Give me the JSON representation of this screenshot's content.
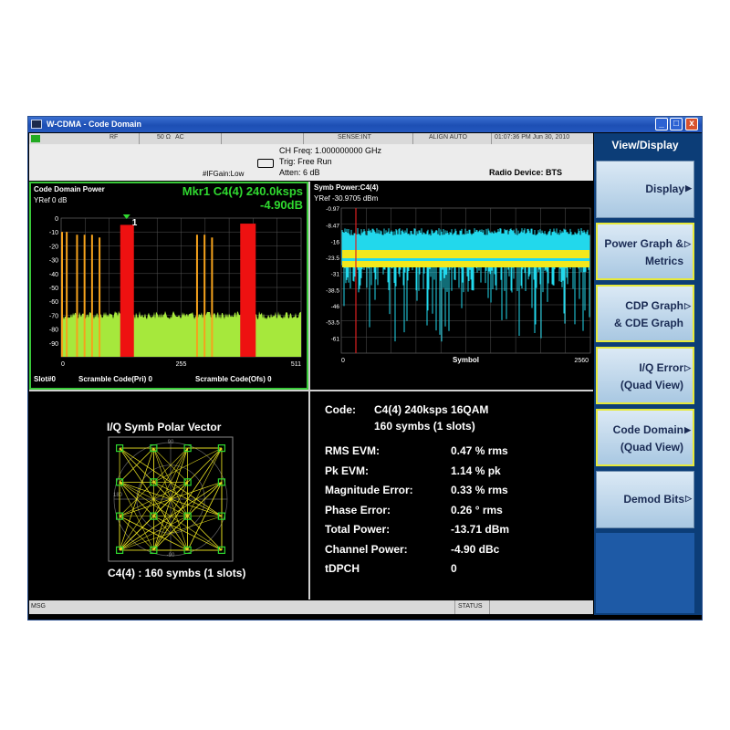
{
  "window": {
    "title": "W-CDMA - Code Domain",
    "min": "_",
    "max": "□",
    "close": "x"
  },
  "status_row": {
    "indicator": "RF",
    "impedance": "50 Ω",
    "coupling": "AC",
    "sense": "SENSE:INT",
    "align": "ALIGN AUTO",
    "datetime": "01:07:36 PM Jun 30, 2010"
  },
  "info": {
    "ifgain": "#IFGain:Low",
    "ch_freq": "CH Freq: 1.000000000 GHz",
    "trig": "Trig: Free Run",
    "atten": "Atten: 6 dB",
    "radio_device": "Radio Device: BTS"
  },
  "cdp_panel": {
    "title": "Code Domain Power",
    "yref": "YRef  0 dB",
    "marker_line1": "Mkr1 C4(4) 240.0ksps",
    "marker_line2": "-4.90dB",
    "marker_label": "1",
    "y_ticks": [
      "0",
      "-10",
      "-20",
      "-30",
      "-40",
      "-50",
      "-60",
      "-70",
      "-80",
      "-90"
    ],
    "x_ticks": [
      "0",
      "255",
      "511"
    ],
    "footer_slot": "Slot#0",
    "footer_pri": "Scramble Code(Pri) 0",
    "footer_ofs": "Scramble Code(Ofs) 0",
    "bars": [
      {
        "code": 0,
        "level": -10,
        "active": false
      },
      {
        "code": 10,
        "level": -10,
        "active": false
      },
      {
        "code": 32,
        "level": -12,
        "active": false
      },
      {
        "code": 48,
        "level": -12,
        "active": false
      },
      {
        "code": 64,
        "level": -12,
        "active": false
      },
      {
        "code": 80,
        "level": -14,
        "active": false
      },
      {
        "code": 128,
        "level": -4.9,
        "active": true
      },
      {
        "code": 288,
        "level": -12,
        "active": false
      },
      {
        "code": 304,
        "level": -12,
        "active": false
      },
      {
        "code": 320,
        "level": -14,
        "active": false
      },
      {
        "code": 384,
        "level": -4,
        "active": true
      }
    ]
  },
  "symb_panel": {
    "title": "Symb Power:C4(4)",
    "yref": "YRef  -30.9705 dBm",
    "y_ticks": [
      "-0.97",
      "-8.47",
      "-16",
      "-23.5",
      "-31",
      "-38.5",
      "-46",
      "-53.5",
      "-61"
    ],
    "x_ticks": [
      "0",
      "Symbol",
      "2560"
    ]
  },
  "polar_panel": {
    "title": "I/Q Symb Polar Vector",
    "footer": "C4(4) : 160 symbs (1 slots)",
    "deg_90": "90",
    "deg_180": "180",
    "deg_neg90": "-90"
  },
  "metrics": {
    "code_label": "Code:",
    "code_value": "C4(4) 240ksps 16QAM",
    "code_sub": "160 symbs (1 slots)",
    "rows": [
      {
        "label": "RMS EVM:",
        "value": "0.47 % rms"
      },
      {
        "label": "Pk EVM:",
        "value": "1.14 % pk"
      },
      {
        "label": "Magnitude Error:",
        "value": "0.33 % rms"
      },
      {
        "label": "Phase Error:",
        "value": "0.26 ° rms"
      },
      {
        "label": "Total Power:",
        "value": "-13.71 dBm"
      },
      {
        "label": "Channel Power:",
        "value": "-4.90 dBc"
      },
      {
        "label": "tDPCH",
        "value": "0"
      }
    ]
  },
  "softkeys": {
    "menu_title": "View/Display",
    "keys": [
      {
        "line1": "Display",
        "line2": "",
        "arrow": "▶"
      },
      {
        "line1": "Power Graph &",
        "line2": "Metrics",
        "arrow": "▷"
      },
      {
        "line1": "CDP Graph",
        "line2": "& CDE Graph",
        "arrow": "▷"
      },
      {
        "line1": "I/Q Error",
        "line2": "(Quad View)",
        "arrow": "▷"
      },
      {
        "line1": "Code Domain",
        "line2": "(Quad View)",
        "arrow": "▶"
      },
      {
        "line1": "Demod Bits",
        "line2": "",
        "arrow": "▷"
      }
    ]
  },
  "bottom": {
    "msg": "MSG",
    "status": "STATUS"
  },
  "colors": {
    "green_border": "#39c839",
    "noise": "#a6e83c",
    "active_bar": "#ee1111",
    "inactive_bar": "#f5a21c",
    "cyan": "#22d8ec",
    "yellow": "#f2e81c",
    "marker": "#2fd82f"
  }
}
